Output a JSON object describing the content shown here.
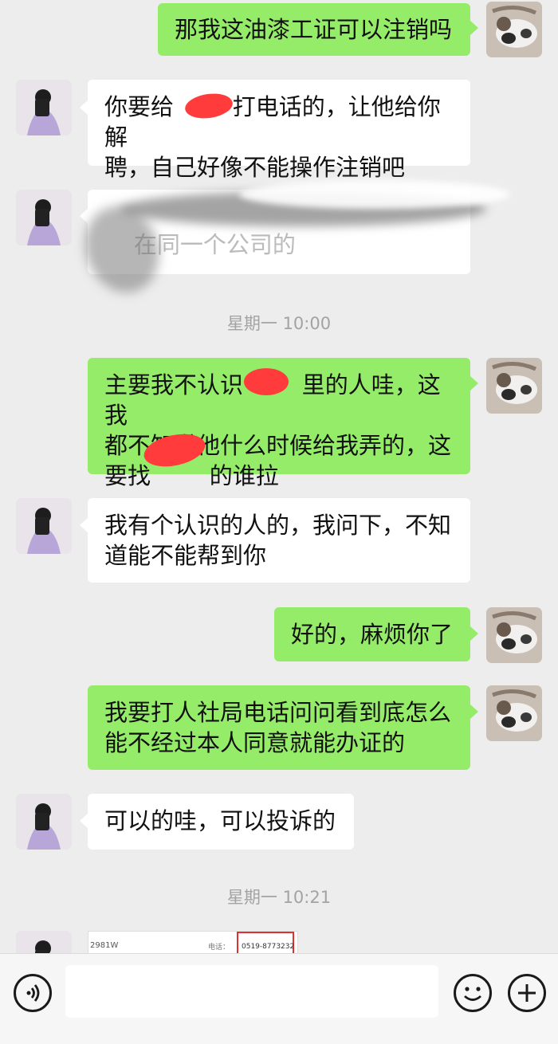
{
  "messages": {
    "m1": "那我这油漆工证可以注销吗",
    "m2": "你要给        打电话的，让他给你解\n聘，自己好像不能操作注销吧",
    "m3": "    在同一个公司的",
    "m4": "主要我不认识        里的人哇，这我\n都不知道他什么时候给我弄的，这\n要找        的谁拉",
    "m5": "我有个认识的人的，我问下，不知\n道能不能帮到你",
    "m6": "好的，麻烦你了",
    "m7": "我要打人社局电话问问看到底怎么\n能不经过本人同意就能办证的",
    "m8": "可以的哇，可以投诉的"
  },
  "timestamps": {
    "t1": "星期一 10:00",
    "t2": "星期一 10:21"
  },
  "image_msg": {
    "left_text": "2981W",
    "mid_text": "电话：",
    "phone": "0519-8773232"
  },
  "colors": {
    "outgoing": "#95ec69",
    "incoming": "#ffffff",
    "background": "#ededed",
    "redact": "#ff3b3b"
  },
  "icons": {
    "voice": "voice-icon",
    "emoji": "emoji-icon",
    "plus": "plus-icon"
  }
}
